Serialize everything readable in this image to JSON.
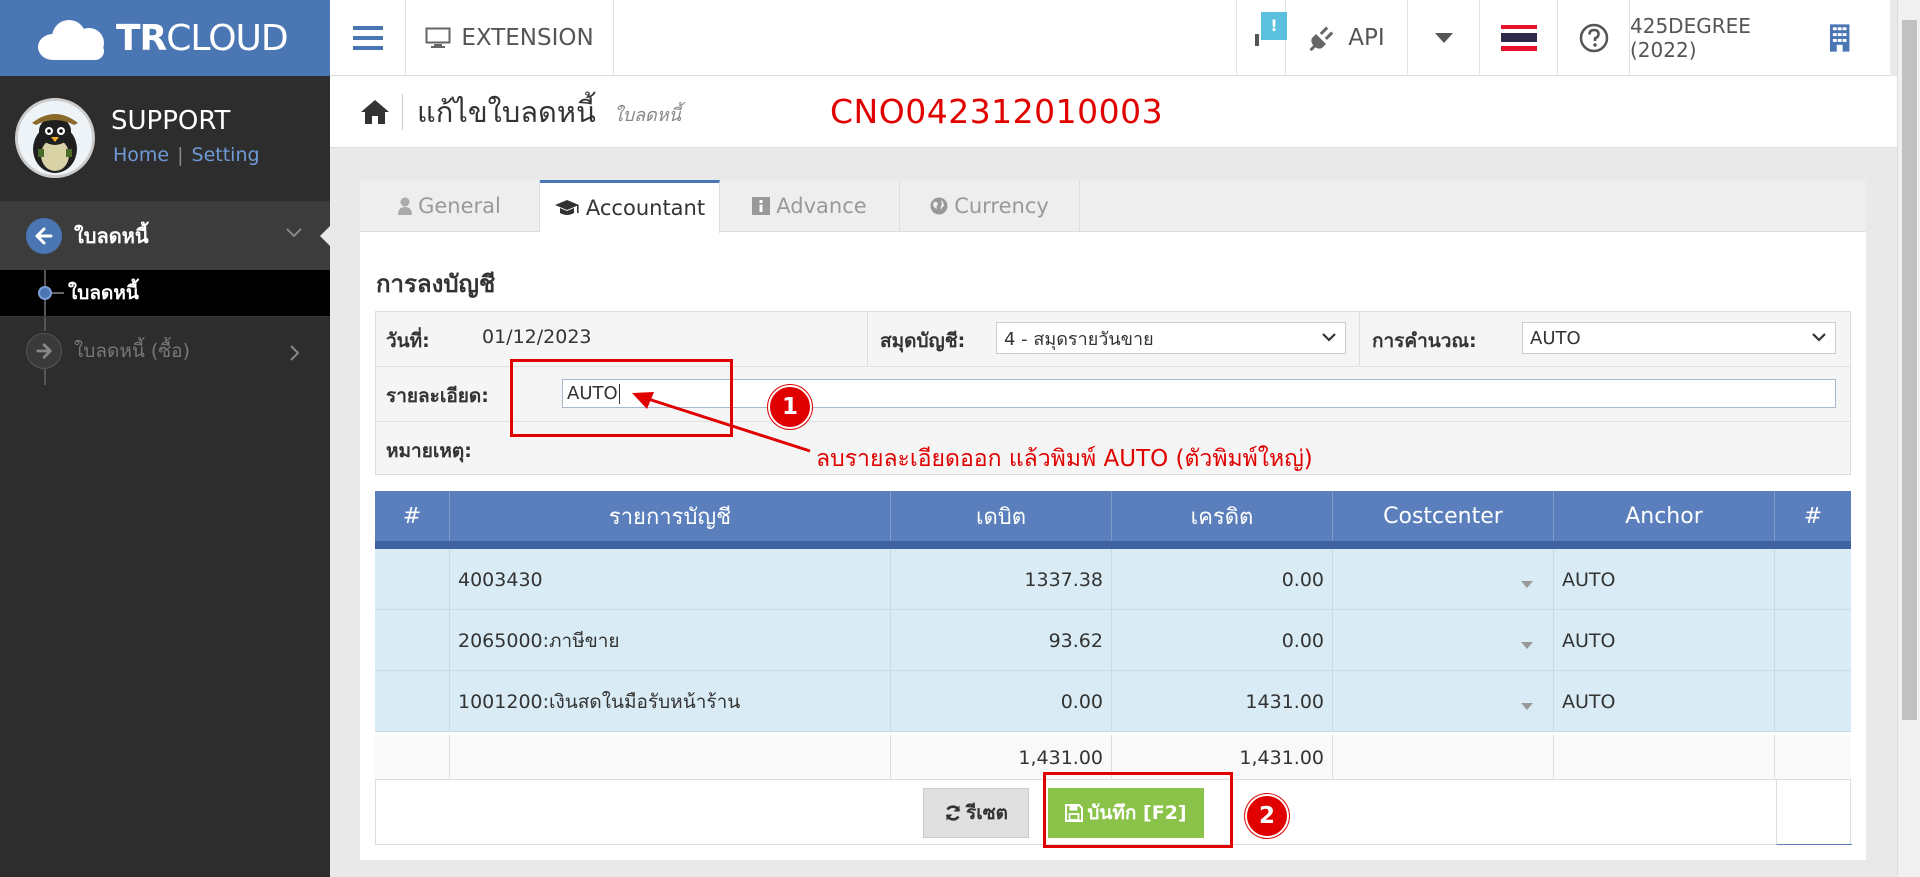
{
  "brand": {
    "logo_bold": "TR",
    "logo_light": "CLOUD"
  },
  "topbar": {
    "extension_label": "EXTENSION",
    "notify_badge": "!",
    "api_label": "API",
    "company": "425DEGREE (2022)"
  },
  "sidebar": {
    "username": "SUPPORT",
    "link_home": "Home",
    "link_sep": "|",
    "link_setting": "Setting",
    "group_label": "ใบลดหนี้",
    "sub_item": "ใบลดหนี้",
    "item2_label": "ใบลดหนี้ (ซื้อ)"
  },
  "page": {
    "title": "แก้ไขใบลดหนี้",
    "subtitle": "ใบลดหนี้",
    "doc_no": "CNO042312010003"
  },
  "tabs": [
    {
      "label": "General"
    },
    {
      "label": "Accountant"
    },
    {
      "label": "Advance"
    },
    {
      "label": "Currency"
    }
  ],
  "form": {
    "section_title": "การลงบัญชี",
    "date_label": "วันที่:",
    "date_value": "01/12/2023",
    "journal_label": "สมุดบัญชี:",
    "journal_value": "4 - สมุดรายวันขาย",
    "calc_label": "การคำนวณ:",
    "calc_value": "AUTO",
    "detail_label": "รายละเอียด:",
    "detail_value": "AUTO",
    "remark_label": "หมายเหตุ:"
  },
  "table": {
    "headers": [
      "#",
      "รายการบัญชี",
      "เดบิต",
      "เครดิต",
      "Costcenter",
      "Anchor",
      "#"
    ],
    "rows": [
      {
        "account": "4003430",
        "debit": "1337.38",
        "credit": "0.00",
        "anchor": "AUTO"
      },
      {
        "account": "2065000:ภาษีขาย",
        "debit": "93.62",
        "credit": "0.00",
        "anchor": "AUTO"
      },
      {
        "account": "1001200:เงินสดในมือรับหน้าร้าน",
        "debit": "0.00",
        "credit": "1431.00",
        "anchor": "AUTO"
      }
    ],
    "total_debit": "1,431.00",
    "total_credit": "1,431.00"
  },
  "buttons": {
    "reset": "รีเซต",
    "save": "บันทึก [F2]"
  },
  "annotations": {
    "step1": "1",
    "step2": "2",
    "note": "ลบรายละเอียดออก แล้วพิมพ์ AUTO (ตัวพิมพ์ใหญ่)"
  },
  "colors": {
    "brand": "#4a76b4",
    "annotation": "#e00000",
    "save": "#8bc34a",
    "table_header": "#5a7fbc"
  }
}
